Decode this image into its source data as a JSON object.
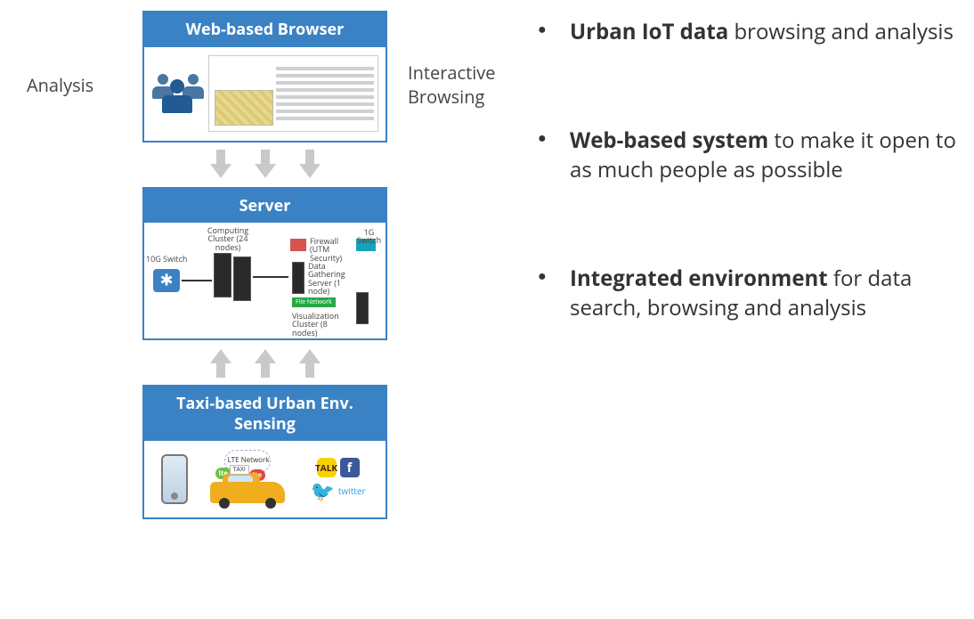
{
  "side_labels": {
    "left": "Analysis",
    "right": "Interactive Browsing"
  },
  "layers": {
    "browser": {
      "title": "Web-based Browser"
    },
    "server": {
      "title": "Server",
      "switch_label": "10G Switch",
      "cluster_label": "Computing Cluster (24 nodes)",
      "firewall_label": "Firewall (UTM Security)",
      "oneg_switch": "1G Switch",
      "datagather_label": "Data Gathering Server (1 node)",
      "filenet_tag": "File Network",
      "viz_label": "Visualization Cluster (8 nodes)"
    },
    "sensing": {
      "title": "Taxi-based Urban Env. Sensing",
      "lte_label": "LTE Network",
      "lte_pill": "lte",
      "taxi_text": "TAXI",
      "kakao": "TALK",
      "fb": "f",
      "tw": "🐦",
      "tw_label": "twitter"
    }
  },
  "bullets": [
    {
      "bold": "Urban IoT data",
      "rest": " browsing and analysis"
    },
    {
      "bold": "Web-based system",
      "rest": " to make it open to as much people as possible"
    },
    {
      "bold": "Integrated environment",
      "rest": " for data search, browsing and analysis"
    }
  ]
}
